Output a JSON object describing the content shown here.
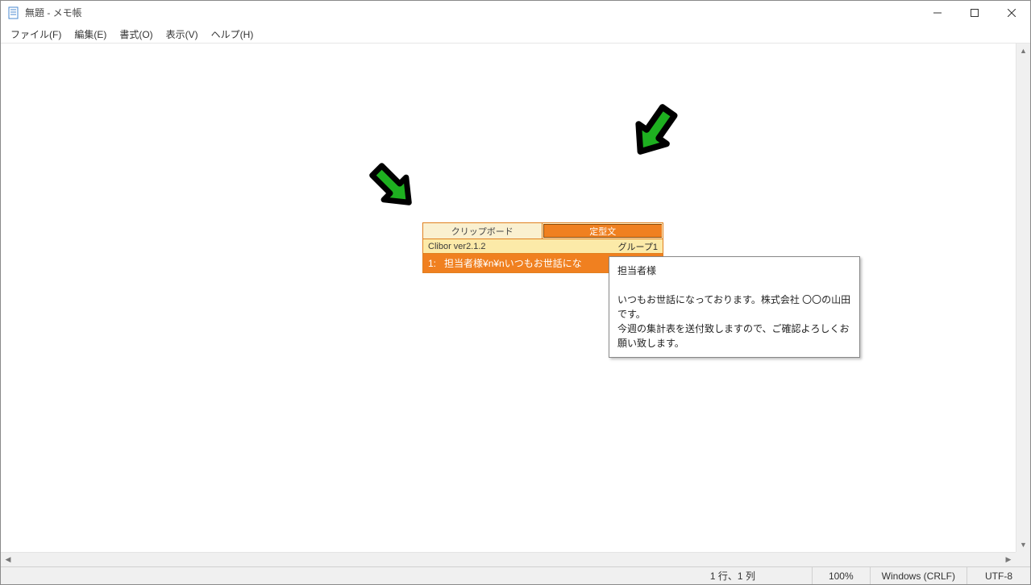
{
  "window": {
    "title": "無題 - メモ帳"
  },
  "menu": {
    "items": [
      "ファイル(F)",
      "編集(E)",
      "書式(O)",
      "表示(V)",
      "ヘルプ(H)"
    ]
  },
  "status": {
    "position": "1 行、1 列",
    "zoom": "100%",
    "lineending": "Windows (CRLF)",
    "encoding": "UTF-8"
  },
  "clibor": {
    "tabs": {
      "clipboard": "クリップボード",
      "teikeibun": "定型文"
    },
    "version": "Clibor ver2.1.2",
    "group": "グループ1",
    "item": {
      "index": "1:",
      "text": "担当者様¥n¥nいつもお世話にな"
    }
  },
  "tooltip": {
    "line1": "担当者様",
    "line2": "いつもお世話になっております。株式会社 〇〇の山田です。",
    "line3": "今週の集計表を送付致しますので、ご確認よろしくお願い致します。"
  }
}
